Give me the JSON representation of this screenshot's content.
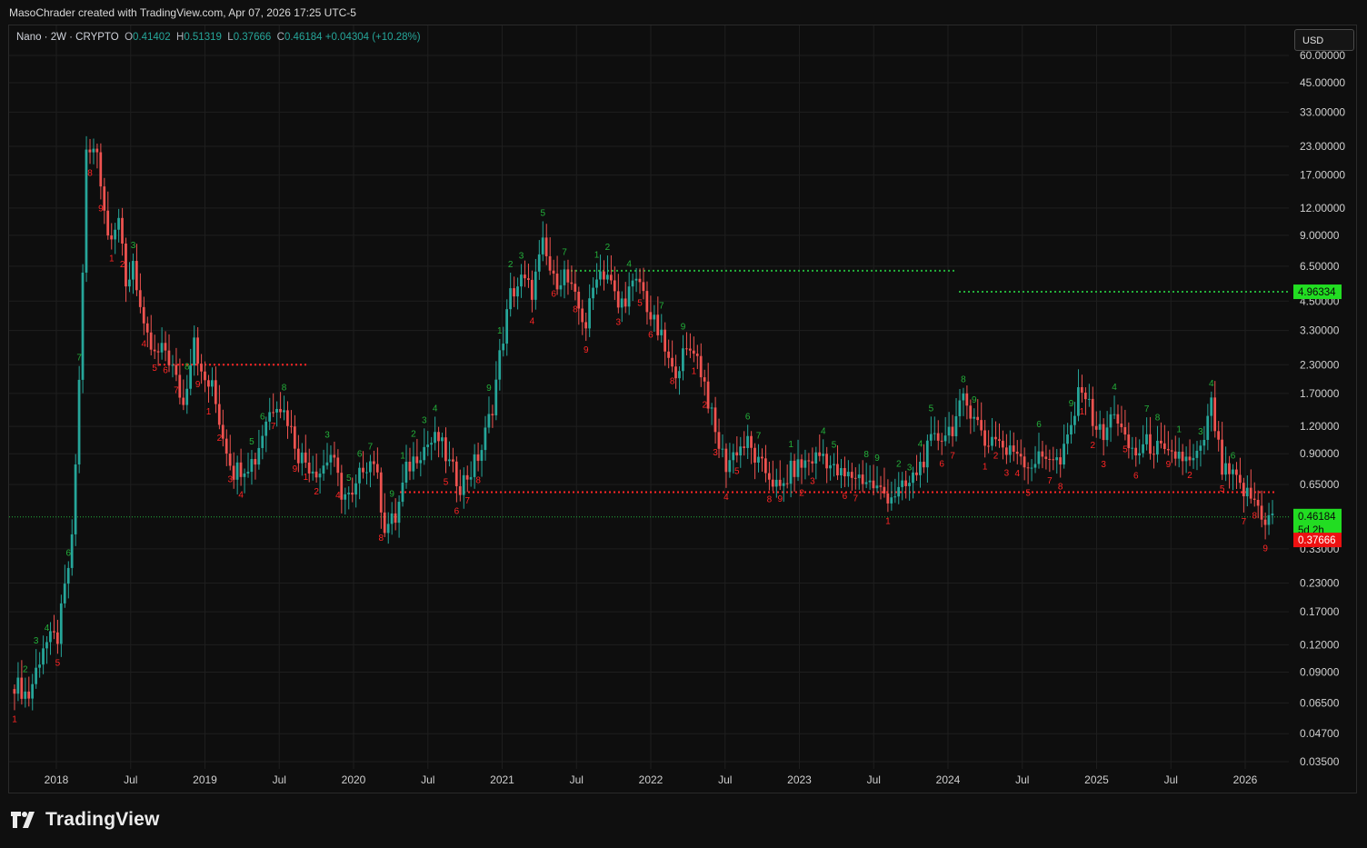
{
  "header": {
    "attribution": "MasoChrader created with TradingView.com, Apr 07, 2026 17:25 UTC-5"
  },
  "symbol": {
    "name": "Nano · 2W · CRYPTO",
    "open_label": "O",
    "open": "0.41402",
    "high_label": "H",
    "high": "0.51319",
    "low_label": "L",
    "low": "0.37666",
    "close_label": "C",
    "close": "0.46184",
    "change": "+0.04304 (+10.28%)"
  },
  "currency_button": "USD",
  "footer": {
    "brand": "TradingView"
  },
  "colors": {
    "up": "#26a69a",
    "down": "#ef5350",
    "green_signal": "#23b03a",
    "red_signal": "#ff2525",
    "bg": "#0e0e0e",
    "grid": "#1e1e1e"
  },
  "chart_data": {
    "type": "candlestick",
    "y_scale": "log",
    "ylim": [
      0.03,
      65
    ],
    "y_ticks": [
      "60.00000",
      "45.00000",
      "33.00000",
      "23.00000",
      "17.00000",
      "12.00000",
      "9.00000",
      "6.50000",
      "4.50000",
      "3.30000",
      "2.30000",
      "1.70000",
      "1.20000",
      "0.90000",
      "0.65000",
      "0.46184",
      "0.33000",
      "0.23000",
      "0.17000",
      "0.12000",
      "0.09000",
      "0.06500",
      "0.04700",
      "0.03500"
    ],
    "x_ticks": [
      "2018",
      "Jul",
      "2019",
      "Jul",
      "2020",
      "Jul",
      "2021",
      "Jul",
      "2022",
      "Jul",
      "2023",
      "Jul",
      "2024",
      "Jul",
      "2025",
      "Jul",
      "2026"
    ],
    "price_badges": {
      "resistance": "4.96334",
      "last": "0.46184",
      "countdown": "5d 2h",
      "low": "0.37666"
    },
    "levels": [
      {
        "value": 0.46184,
        "style": "dotted",
        "color": "#23b03a"
      },
      {
        "value": 6.2,
        "style": "dotted",
        "color": "#23b03a"
      },
      {
        "value": 4.96334,
        "style": "dotted",
        "color": "#23b03a"
      },
      {
        "value": 2.3,
        "style": "dotted",
        "color": "#ff2525"
      },
      {
        "value": 0.6,
        "style": "dotted",
        "color": "#ff2525"
      }
    ],
    "anchor_points": [
      [
        0,
        0.08
      ],
      [
        4,
        0.07
      ],
      [
        8,
        0.12
      ],
      [
        12,
        0.13
      ],
      [
        16,
        0.35
      ],
      [
        18,
        1.9
      ],
      [
        20,
        21
      ],
      [
        23,
        22
      ],
      [
        26,
        9
      ],
      [
        29,
        11
      ],
      [
        31,
        5
      ],
      [
        33,
        7
      ],
      [
        36,
        3.2
      ],
      [
        39,
        2.5
      ],
      [
        42,
        2.7
      ],
      [
        44,
        2.2
      ],
      [
        47,
        1.5
      ],
      [
        50,
        3.2
      ],
      [
        52,
        2.0
      ],
      [
        55,
        1.8
      ],
      [
        58,
        1.1
      ],
      [
        61,
        0.75
      ],
      [
        64,
        0.8
      ],
      [
        67,
        0.85
      ],
      [
        70,
        1.3
      ],
      [
        73,
        1.6
      ],
      [
        76,
        1.3
      ],
      [
        79,
        0.9
      ],
      [
        82,
        0.8
      ],
      [
        85,
        0.75
      ],
      [
        88,
        0.9
      ],
      [
        91,
        0.6
      ],
      [
        94,
        0.55
      ],
      [
        97,
        0.8
      ],
      [
        100,
        0.85
      ],
      [
        103,
        0.42
      ],
      [
        106,
        0.45
      ],
      [
        109,
        0.75
      ],
      [
        112,
        0.9
      ],
      [
        115,
        1.0
      ],
      [
        118,
        1.05
      ],
      [
        121,
        0.8
      ],
      [
        124,
        0.65
      ],
      [
        127,
        0.75
      ],
      [
        130,
        0.95
      ],
      [
        133,
        1.5
      ],
      [
        135,
        2.5
      ],
      [
        138,
        4.8
      ],
      [
        141,
        5.6
      ],
      [
        144,
        5.0
      ],
      [
        147,
        8.0
      ],
      [
        150,
        5.5
      ],
      [
        153,
        6.0
      ],
      [
        156,
        4.5
      ],
      [
        159,
        3.5
      ],
      [
        162,
        6.2
      ],
      [
        165,
        6.0
      ],
      [
        168,
        4.2
      ],
      [
        171,
        5.0
      ],
      [
        174,
        5.5
      ],
      [
        177,
        3.8
      ],
      [
        180,
        3.0
      ],
      [
        183,
        2.1
      ],
      [
        186,
        2.5
      ],
      [
        189,
        2.8
      ],
      [
        192,
        1.9
      ],
      [
        195,
        1.1
      ],
      [
        198,
        0.8
      ],
      [
        201,
        0.95
      ],
      [
        204,
        1.0
      ],
      [
        207,
        0.8
      ],
      [
        210,
        0.72
      ],
      [
        213,
        0.6
      ],
      [
        216,
        0.75
      ],
      [
        219,
        0.8
      ],
      [
        222,
        0.85
      ],
      [
        225,
        0.9
      ],
      [
        228,
        0.75
      ],
      [
        231,
        0.7
      ],
      [
        234,
        0.72
      ],
      [
        237,
        0.68
      ],
      [
        240,
        0.62
      ],
      [
        243,
        0.58
      ],
      [
        246,
        0.6
      ],
      [
        249,
        0.65
      ],
      [
        252,
        0.8
      ],
      [
        255,
        1.0
      ],
      [
        258,
        1.1
      ],
      [
        261,
        1.2
      ],
      [
        264,
        1.55
      ],
      [
        267,
        1.4
      ],
      [
        270,
        1.0
      ],
      [
        273,
        1.1
      ],
      [
        276,
        0.9
      ],
      [
        279,
        0.95
      ],
      [
        282,
        0.8
      ],
      [
        285,
        0.85
      ],
      [
        288,
        0.9
      ],
      [
        291,
        0.8
      ],
      [
        294,
        1.2
      ],
      [
        297,
        1.9
      ],
      [
        300,
        1.3
      ],
      [
        303,
        1.05
      ],
      [
        306,
        1.45
      ],
      [
        309,
        1.0
      ],
      [
        312,
        0.9
      ],
      [
        315,
        1.0
      ],
      [
        318,
        0.95
      ],
      [
        321,
        0.85
      ],
      [
        324,
        0.9
      ],
      [
        327,
        0.8
      ],
      [
        330,
        0.9
      ],
      [
        333,
        1.5
      ],
      [
        336,
        0.75
      ],
      [
        339,
        0.7
      ],
      [
        342,
        0.6
      ],
      [
        345,
        0.55
      ],
      [
        348,
        0.45
      ],
      [
        350,
        0.46
      ]
    ],
    "td_labels_sample": [
      "1",
      "2",
      "3",
      "4",
      "5",
      "6",
      "7",
      "8",
      "9"
    ]
  }
}
